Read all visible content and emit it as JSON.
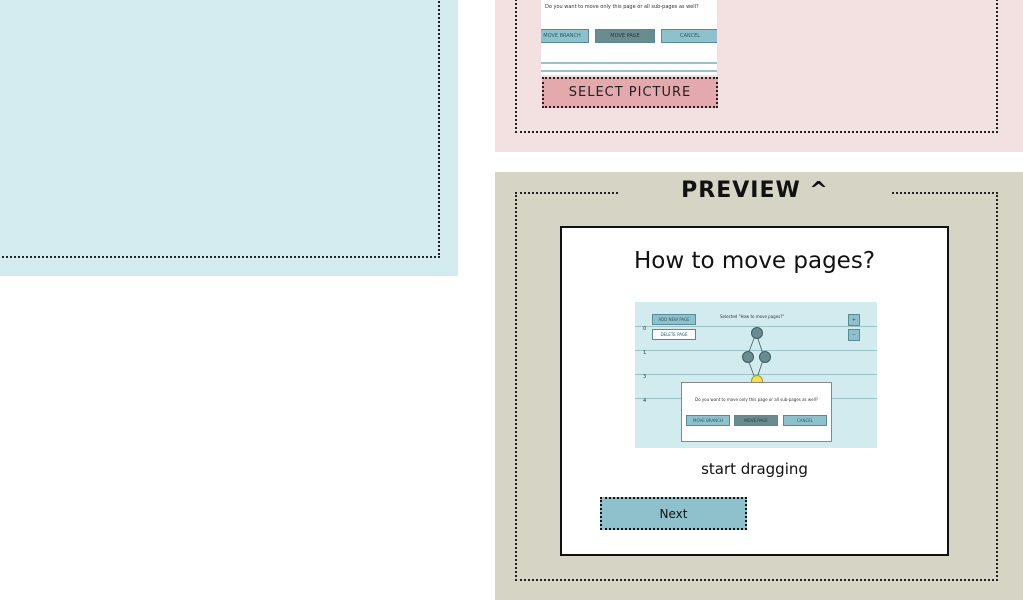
{
  "picture_panel": {
    "thumbnail": {
      "question": "Do you want to move only this page or all sub-pages as well?",
      "buttons": [
        "MOVE BRANCH",
        "MOVE PAGE",
        "CANCEL"
      ]
    },
    "select_picture_label": "SELECT PICTURE"
  },
  "preview": {
    "heading": "PREVIEW ^",
    "card_title": "How to move pages?",
    "image": {
      "add_page": "ADD NEW PAGE",
      "delete_page": "DELETE PAGE",
      "selected": "Selected \"How to move pages?\"",
      "question": "Do you want to move only this page or all sub-pages as well?",
      "buttons": [
        "MOVE BRANCH",
        "MOVE PAGE",
        "CANCEL"
      ],
      "row_labels": [
        "0",
        "1",
        "3",
        "4"
      ]
    },
    "caption": "start dragging",
    "next_label": "Next"
  },
  "colors": {
    "left_bg": "#d4ecf0",
    "picture_bg": "#f3e0e1",
    "preview_bg": "#d6d4c5",
    "button_blue": "#8fc1cc",
    "button_pink": "#e3a9ad"
  }
}
